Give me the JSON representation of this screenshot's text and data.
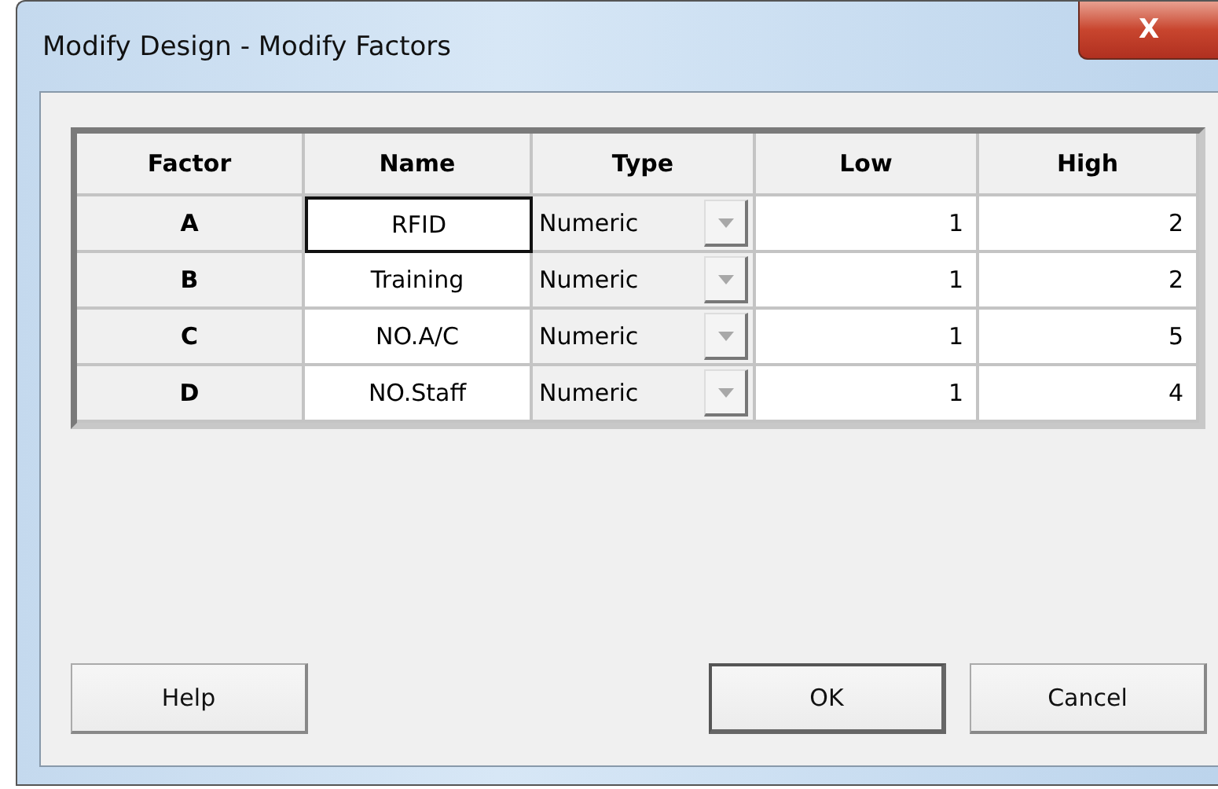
{
  "window": {
    "title": "Modify Design - Modify Factors",
    "close_symbol": "X"
  },
  "table": {
    "columns": [
      "Factor",
      "Name",
      "Type",
      "Low",
      "High"
    ],
    "rows": [
      {
        "factor": "A",
        "name": "RFID",
        "type": "Numeric",
        "low": "1",
        "high": "2",
        "selected": true
      },
      {
        "factor": "B",
        "name": "Training",
        "type": "Numeric",
        "low": "1",
        "high": "2",
        "selected": false
      },
      {
        "factor": "C",
        "name": "NO.A/C",
        "type": "Numeric",
        "low": "1",
        "high": "5",
        "selected": false
      },
      {
        "factor": "D",
        "name": "NO.Staff",
        "type": "Numeric",
        "low": "1",
        "high": "4",
        "selected": false
      }
    ]
  },
  "buttons": [
    {
      "label": "Help",
      "default": false
    },
    {
      "label": "OK",
      "default": true
    },
    {
      "label": "Cancel",
      "default": false
    }
  ]
}
